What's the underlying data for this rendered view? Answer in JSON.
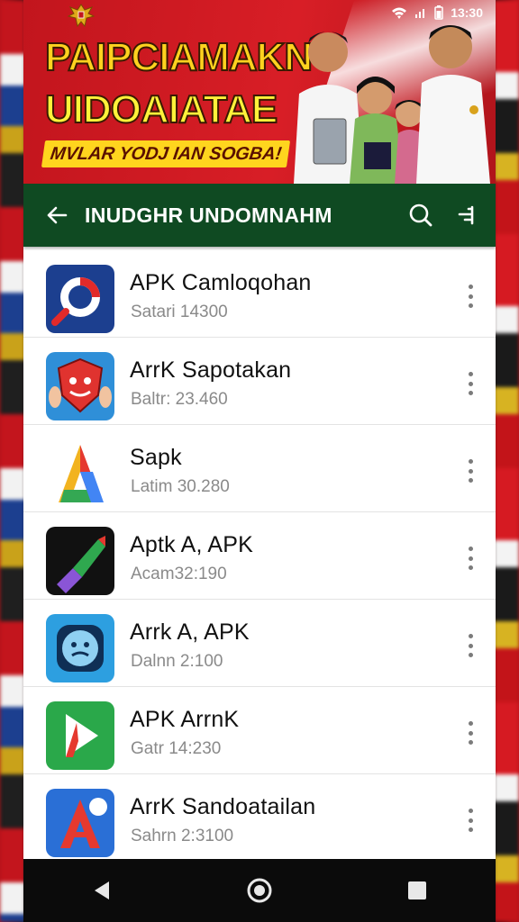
{
  "banner": {
    "title_line1": "PAIPCIAMAKN",
    "title_line2": "UIDOAIATAE",
    "subtitle": "MVLAR YODJ IAN SOGBA!"
  },
  "status": {
    "time": "13:30"
  },
  "appbar": {
    "title": "INUDGHR UNDOMNAHM"
  },
  "apps": [
    {
      "name": "APK Camloqohan",
      "meta": "Satari 14300",
      "icon": "blue-circle-magnifier-icon"
    },
    {
      "name": "ArrK Sapotakan",
      "meta": "Baltr: 23.460",
      "icon": "red-shield-mascot-icon"
    },
    {
      "name": "Sapk",
      "meta": "Latim 30.280",
      "icon": "colorful-a-letter-icon"
    },
    {
      "name": "Aptk A, APK",
      "meta": "Acam32:190",
      "icon": "dark-pen-brush-icon"
    },
    {
      "name": "Arrk A, APK",
      "meta": "Dalnn 2:100",
      "icon": "blue-face-badge-icon"
    },
    {
      "name": "APK ArrnK",
      "meta": "Gatr 14:230",
      "icon": "green-play-a-icon"
    },
    {
      "name": "ArrK Sandoatailan",
      "meta": "Sahrn 2:3100",
      "icon": "blue-a-letter-icon"
    }
  ],
  "colors": {
    "banner_red": "#c2151d",
    "appbar_green": "#0f4a22",
    "title_yellow": "#ffd21f"
  }
}
